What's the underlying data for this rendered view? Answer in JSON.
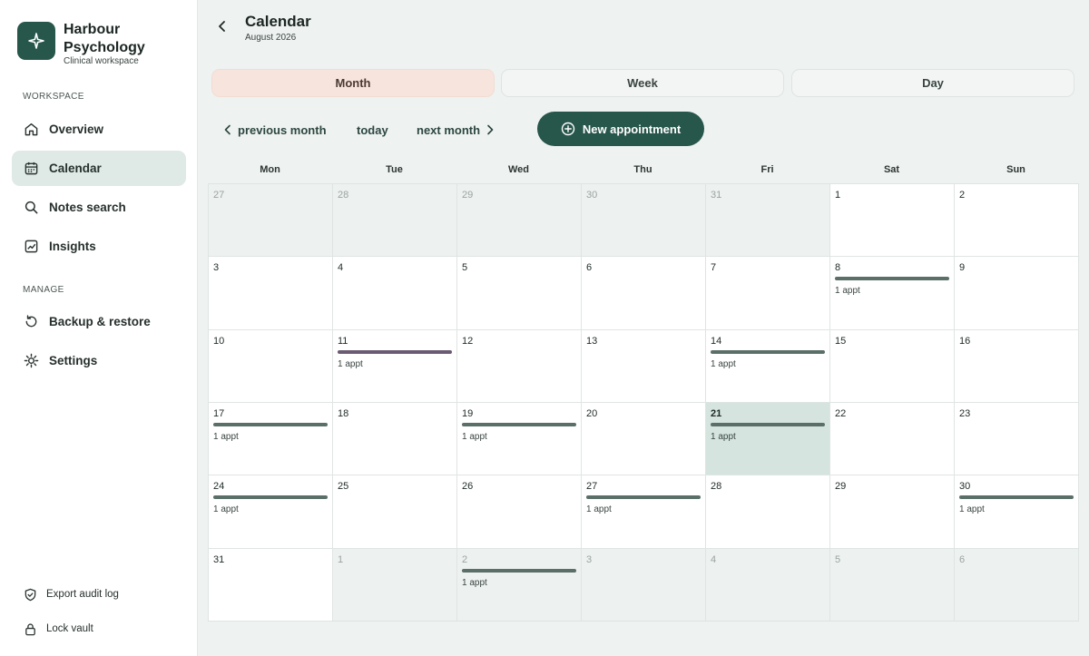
{
  "brand": {
    "name": "Harbour Psychology",
    "subtitle": "Clinical workspace"
  },
  "sidebar": {
    "workspace_label": "WORKSPACE",
    "manage_label": "MANAGE",
    "workspace_items": [
      {
        "label": "Overview",
        "icon": "home-icon"
      },
      {
        "label": "Calendar",
        "icon": "calendar-icon",
        "active": true
      },
      {
        "label": "Notes search",
        "icon": "search-icon"
      },
      {
        "label": "Insights",
        "icon": "chart-icon"
      }
    ],
    "manage_items": [
      {
        "label": "Backup & restore",
        "icon": "restore-icon"
      },
      {
        "label": "Settings",
        "icon": "gear-icon"
      }
    ],
    "footer_items": [
      {
        "label": "Export audit log",
        "icon": "shield-icon"
      },
      {
        "label": "Lock vault",
        "icon": "lock-icon"
      }
    ]
  },
  "header": {
    "title": "Calendar",
    "subtitle": "August 2026"
  },
  "view_tabs": [
    {
      "label": "Month",
      "active": true
    },
    {
      "label": "Week",
      "active": false
    },
    {
      "label": "Day",
      "active": false
    }
  ],
  "toolbar": {
    "previous_label": "previous month",
    "today_label": "today",
    "next_label": "next month",
    "new_appointment_label": "New appointment"
  },
  "weekdays": [
    "Mon",
    "Tue",
    "Wed",
    "Thu",
    "Fri",
    "Sat",
    "Sun"
  ],
  "colors": {
    "accent": "#27564b",
    "active_tab": "#f7e4dc",
    "today_cell": "#d5e4de",
    "appt_bar": "#5a6f68",
    "appt_bar_alt": "#6a5a73"
  },
  "days": [
    {
      "num": "27",
      "out": true
    },
    {
      "num": "28",
      "out": true
    },
    {
      "num": "29",
      "out": true
    },
    {
      "num": "30",
      "out": true
    },
    {
      "num": "31",
      "out": true
    },
    {
      "num": "1"
    },
    {
      "num": "2"
    },
    {
      "num": "3"
    },
    {
      "num": "4"
    },
    {
      "num": "5"
    },
    {
      "num": "6"
    },
    {
      "num": "7"
    },
    {
      "num": "8",
      "appt": "1 appt"
    },
    {
      "num": "9"
    },
    {
      "num": "10"
    },
    {
      "num": "11",
      "appt": "1 appt",
      "bar": "purple"
    },
    {
      "num": "12"
    },
    {
      "num": "13"
    },
    {
      "num": "14",
      "appt": "1 appt"
    },
    {
      "num": "15"
    },
    {
      "num": "16"
    },
    {
      "num": "17",
      "appt": "1 appt"
    },
    {
      "num": "18"
    },
    {
      "num": "19",
      "appt": "1 appt"
    },
    {
      "num": "20"
    },
    {
      "num": "21",
      "appt": "1 appt",
      "today": true
    },
    {
      "num": "22"
    },
    {
      "num": "23"
    },
    {
      "num": "24",
      "appt": "1 appt"
    },
    {
      "num": "25"
    },
    {
      "num": "26"
    },
    {
      "num": "27",
      "appt": "1 appt"
    },
    {
      "num": "28"
    },
    {
      "num": "29"
    },
    {
      "num": "30",
      "appt": "1 appt"
    },
    {
      "num": "31"
    },
    {
      "num": "1",
      "out": true
    },
    {
      "num": "2",
      "out": true,
      "appt": "1 appt"
    },
    {
      "num": "3",
      "out": true
    },
    {
      "num": "4",
      "out": true
    },
    {
      "num": "5",
      "out": true
    },
    {
      "num": "6",
      "out": true
    }
  ]
}
